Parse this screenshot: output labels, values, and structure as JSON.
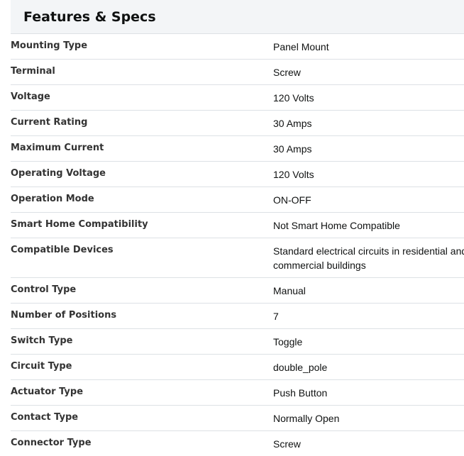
{
  "section": {
    "title": "Features & Specs"
  },
  "specs": [
    {
      "label": "Mounting Type",
      "value": "Panel Mount"
    },
    {
      "label": "Terminal",
      "value": "Screw"
    },
    {
      "label": "Voltage",
      "value": "120 Volts"
    },
    {
      "label": "Current Rating",
      "value": "30 Amps"
    },
    {
      "label": "Maximum Current",
      "value": "30 Amps"
    },
    {
      "label": "Operating Voltage",
      "value": "120 Volts"
    },
    {
      "label": "Operation Mode",
      "value": "ON-OFF"
    },
    {
      "label": "Smart Home Compatibility",
      "value": "Not Smart Home Compatible"
    },
    {
      "label": "Compatible Devices",
      "value": "Standard electrical circuits in residential and commercial buildings",
      "value_lines": [
        "Standard electrical circuits in residential and",
        "commercial buildings"
      ]
    },
    {
      "label": "Control Type",
      "value": "Manual"
    },
    {
      "label": "Number of Positions",
      "value": "7"
    },
    {
      "label": "Switch Type",
      "value": "Toggle"
    },
    {
      "label": "Circuit Type",
      "value": "double_pole"
    },
    {
      "label": "Actuator Type",
      "value": "Push Button"
    },
    {
      "label": "Contact Type",
      "value": "Normally Open"
    },
    {
      "label": "Connector Type",
      "value": "Screw"
    }
  ]
}
